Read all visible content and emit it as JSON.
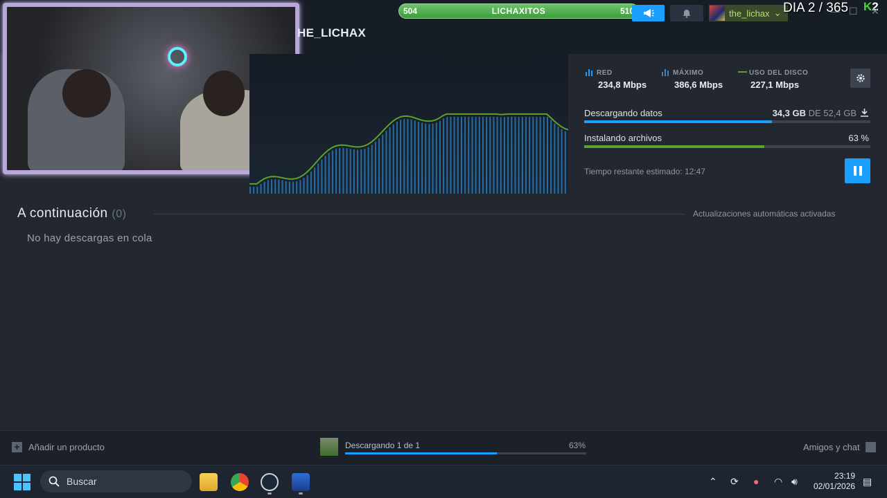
{
  "window": {
    "game_title": "HE_LICHAX",
    "minimize": "—",
    "maximize": "☐",
    "close": "✕"
  },
  "overlay": {
    "xp_left": "504",
    "xp_name": "LICHAXITOS",
    "xp_right": "510",
    "day_counter": "DIA 2 / 365",
    "logo_k": "K",
    "logo_num": "2"
  },
  "header": {
    "user_name": "the_lichax",
    "user_chevron": "⌄"
  },
  "stats": {
    "network_label": "RED",
    "network_value": "234,8 Mbps",
    "peak_label": "MÁXIMO",
    "peak_value": "386,6 Mbps",
    "disk_label": "USO DEL DISCO",
    "disk_value": "227,1 Mbps",
    "colors": {
      "network": "#1a9fff",
      "disk": "#5ba32b"
    }
  },
  "progress": {
    "downloading_label": "Descargando datos",
    "downloaded": "34,3 GB",
    "of_word": "DE",
    "total": "52,4 GB",
    "download_fraction": 0.655,
    "installing_label": "Instalando archivos",
    "install_pct": "63 %",
    "install_fraction": 0.63,
    "eta_label": "Tiempo restante estimado: 12:47"
  },
  "queue": {
    "title": "A continuación",
    "count": "(0)",
    "auto_updates": "Actualizaciones automáticas activadas",
    "empty": "No hay descargas en cola"
  },
  "footer": {
    "add_product": "Añadir un producto",
    "dl_status": "Descargando 1 de 1",
    "dl_pct": "63%",
    "dl_fraction": 0.63,
    "friends": "Amigos y chat"
  },
  "taskbar": {
    "search_placeholder": "Buscar",
    "time": "23:19",
    "date": "02/01/2026"
  }
}
